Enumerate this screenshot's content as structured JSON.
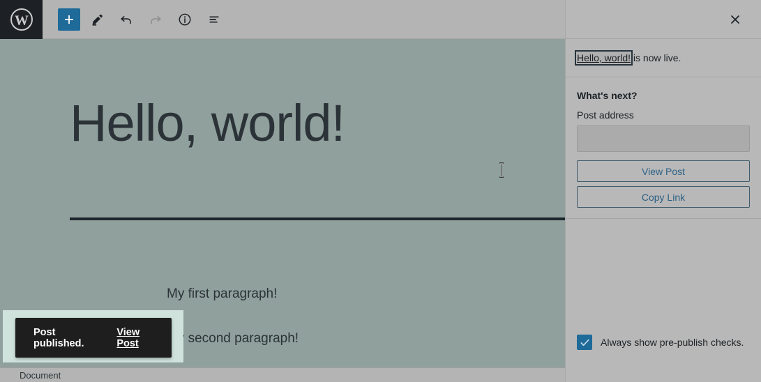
{
  "app": {
    "name": "WordPress Block Editor"
  },
  "toolbar": {
    "logo_name": "wordpress-logo",
    "items": [
      {
        "icon": "plus-icon",
        "label": "Toggle block inserter",
        "state": "active"
      },
      {
        "icon": "pencil-icon",
        "label": "Tools",
        "state": "default"
      },
      {
        "icon": "undo-arrow-icon",
        "label": "Undo",
        "state": "default"
      },
      {
        "icon": "redo-arrow-icon",
        "label": "Redo",
        "state": "disabled"
      },
      {
        "icon": "info-circle-icon",
        "label": "Details",
        "state": "default"
      },
      {
        "icon": "list-view-icon",
        "label": "List view",
        "state": "default"
      }
    ]
  },
  "editor": {
    "title": "Hello, world!",
    "paragraphs": [
      "My first paragraph!",
      "My second paragraph!"
    ],
    "separator_name": "separator-block",
    "cursor": "text-caret",
    "canvas_color": "#90a09c",
    "text_color": "#2b3338"
  },
  "snackbar": {
    "message": "Post published.",
    "action_label": "View Post",
    "background": "#1e1e1e",
    "highlight": "#cfe3dc"
  },
  "statusbar": {
    "document_label": "Document"
  },
  "sidebar": {
    "close_label": "Close panel",
    "live_notice": {
      "link_text": "Hello, world!",
      "suffix": " is now live."
    },
    "whats_next": {
      "heading": "What's next?",
      "address_label": "Post address",
      "address_value": "",
      "address_placeholder": "",
      "view_post_label": "View Post",
      "copy_link_label": "Copy Link"
    },
    "prepublish_checkbox": {
      "label": "Always show pre-publish checks.",
      "checked": true,
      "accent": "#1e6a99"
    },
    "background": "#b8b8b8"
  }
}
